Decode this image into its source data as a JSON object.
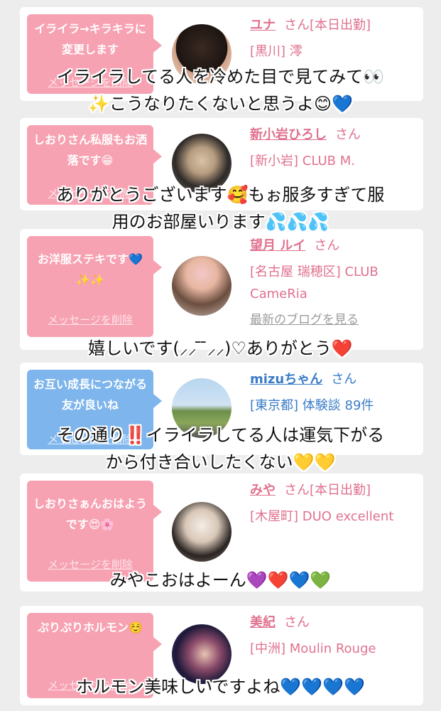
{
  "cards": [
    {
      "bubble": "イライラ→キラキラに変更します",
      "delete": "メッセージを削除",
      "name": "ユナ",
      "san": "さん",
      "status": "[本日出勤]",
      "shop": "[黒川] 澪",
      "blog": "最新のブログを見る"
    },
    {
      "bubble": "しおりさん私服もお洒落です😁",
      "delete": "メッセージを削除",
      "name": "新小岩ひろし",
      "san": "さん",
      "status": "",
      "shop": "[新小岩] CLUB M.",
      "blog": "最新のブログを見る"
    },
    {
      "bubble": "お洋服ステキです💙✨✨",
      "delete": "メッセージを削除",
      "name": "望月 ルイ",
      "san": "さん",
      "status": "",
      "shop": "[名古屋 瑞穂区] CLUB CameRia",
      "blog": "最新のブログを見る"
    },
    {
      "bubble": "お互い成長につながる友が良いね",
      "delete": "メッセージを削除",
      "name": "mizuちゃん",
      "san": "さん",
      "status": "",
      "shop": "[東京都] 体験談 89件",
      "blog": "最新の体験談を見る"
    },
    {
      "bubble": "しおりさぁんおはようです😍🌸",
      "delete": "メッセージを削除",
      "name": "みや",
      "san": "さん",
      "status": "[本日出勤]",
      "shop": "[木屋町] DUO excellent",
      "blog": "最新のブログを見る"
    },
    {
      "bubble": "ぷりぷりホルモン☺️",
      "delete": "メッセージを削除",
      "name": "美紀",
      "san": "さん",
      "status": "",
      "shop": "[中洲] Moulin Rouge",
      "blog": "最新のブログを見る"
    }
  ],
  "overlays": [
    "イライラしてる人を冷めた目で見てみて👀",
    "✨こうなりたくないと思うよ😊💙",
    "ありがとうございます🥰もぉ服多すぎて服",
    "用のお部屋いります💦💦💦",
    "嬉しいです(⸝⸝ ̄ ̄⸝⸝)♡ありがとう❤️",
    "その通り‼️イライラしてる人は運気下がる",
    "から付き合いしたくない💛💛",
    "みやこおはよーん💜❤️💙💚",
    "ホルモン美味しいですよね💙💙💙💙"
  ],
  "colors": {
    "pink": "#f7a2b2",
    "blue": "#7db5ec",
    "name_pink": "#e0718e",
    "name_blue": "#3a7cc7"
  }
}
